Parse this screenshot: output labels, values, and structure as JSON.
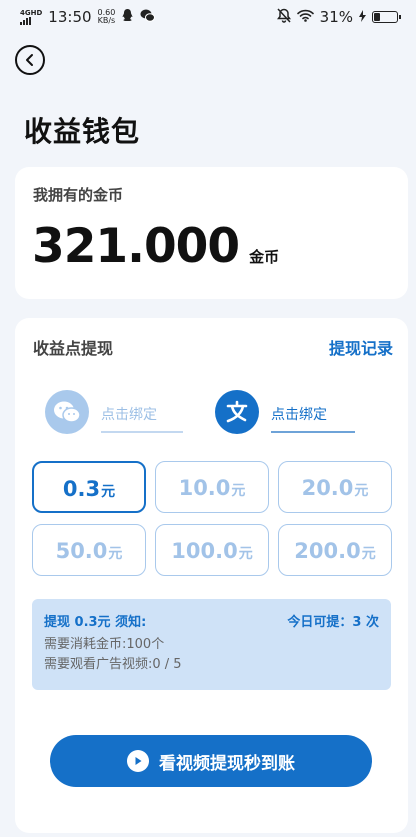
{
  "status_bar": {
    "network": "4GHD",
    "time": "13:50",
    "speed_value": "0.60",
    "speed_unit": "KB/s",
    "battery": "31%",
    "battery_level": 0.31
  },
  "header": {
    "title": "收益钱包"
  },
  "balance": {
    "label": "我拥有的金币",
    "value": "321.000",
    "unit": "金币"
  },
  "withdraw": {
    "title": "收益点提现",
    "record_link": "提现记录",
    "bind_wechat_label": "点击绑定",
    "bind_alipay_label": "点击绑定",
    "amounts": [
      {
        "value": "0.3",
        "unit": "元",
        "selected": true
      },
      {
        "value": "10.0",
        "unit": "元",
        "selected": false
      },
      {
        "value": "20.0",
        "unit": "元",
        "selected": false
      },
      {
        "value": "50.0",
        "unit": "元",
        "selected": false
      },
      {
        "value": "100.0",
        "unit": "元",
        "selected": false
      },
      {
        "value": "200.0",
        "unit": "元",
        "selected": false
      }
    ],
    "notice": {
      "heading": "提现 0.3元 须知:",
      "today_available": "今日可提：3 次",
      "line1": "需要消耗金币:100个",
      "line2": "需要观看广告视频:0 / 5"
    },
    "cta_label": "看视频提现秒到账"
  },
  "colors": {
    "accent": "#1570c8",
    "accent_light": "#a9c9ec",
    "notice_bg": "#cfe2f7",
    "page_bg": "#f2f5fa"
  }
}
